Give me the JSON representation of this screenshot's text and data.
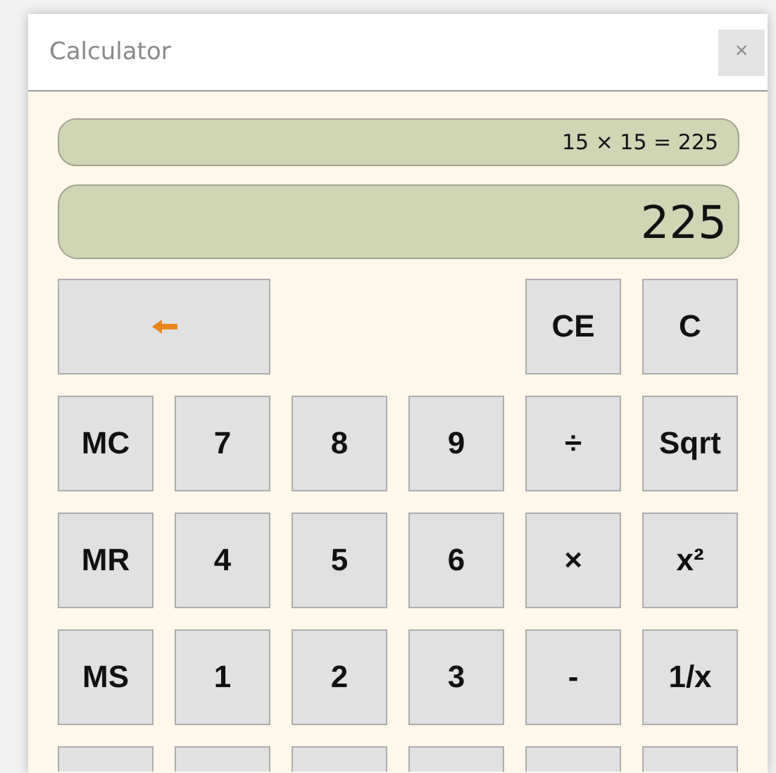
{
  "window": {
    "title": "Calculator",
    "close_label": "×"
  },
  "history": "15 × 15 = 225",
  "display": "225",
  "key_rows": [
    [
      {
        "kind": "backspace"
      },
      {
        "kind": "key",
        "label": "CE"
      },
      {
        "kind": "key",
        "label": "C"
      }
    ],
    [
      {
        "kind": "key",
        "label": "MC"
      },
      {
        "kind": "key",
        "label": "7"
      },
      {
        "kind": "key",
        "label": "8"
      },
      {
        "kind": "key",
        "label": "9"
      },
      {
        "kind": "key",
        "label": "÷"
      },
      {
        "kind": "key",
        "label": "Sqrt"
      }
    ],
    [
      {
        "kind": "key",
        "label": "MR"
      },
      {
        "kind": "key",
        "label": "4"
      },
      {
        "kind": "key",
        "label": "5"
      },
      {
        "kind": "key",
        "label": "6"
      },
      {
        "kind": "key",
        "label": "×"
      },
      {
        "kind": "key",
        "label": "x²"
      }
    ],
    [
      {
        "kind": "key",
        "label": "MS"
      },
      {
        "kind": "key",
        "label": "1"
      },
      {
        "kind": "key",
        "label": "2"
      },
      {
        "kind": "key",
        "label": "3"
      },
      {
        "kind": "key",
        "label": "-"
      },
      {
        "kind": "key",
        "label": "1/x"
      }
    ],
    [
      {
        "kind": "cut"
      },
      {
        "kind": "cut"
      },
      {
        "kind": "cut"
      },
      {
        "kind": "cut"
      },
      {
        "kind": "cut"
      },
      {
        "kind": "cut"
      }
    ]
  ]
}
